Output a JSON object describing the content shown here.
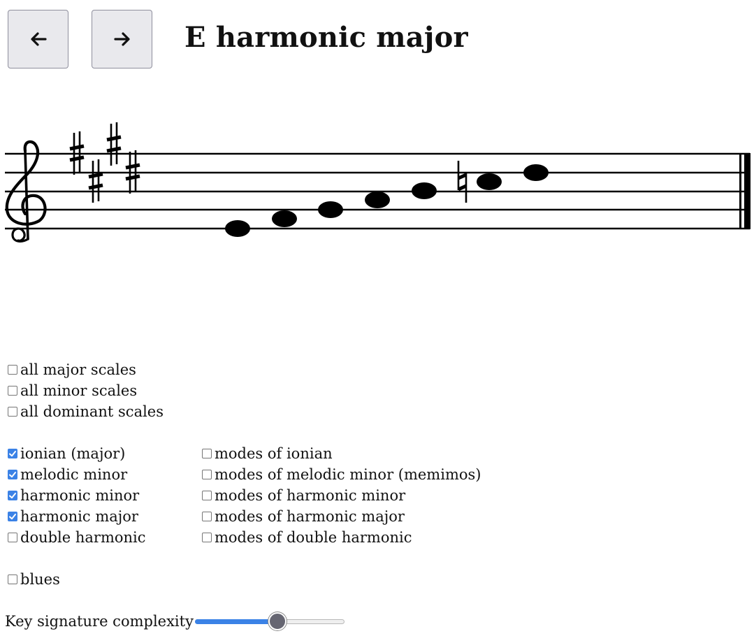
{
  "header": {
    "prev_icon": "arrow-left-icon",
    "next_icon": "arrow-right-icon",
    "title": "E harmonic major"
  },
  "staff": {
    "clef": "treble-clef",
    "key_signature": [
      "F#",
      "C#",
      "G#",
      "D#"
    ],
    "notes": [
      "E4",
      "F#4",
      "G#4",
      "A4",
      "B4",
      "C5",
      "D#5"
    ],
    "accidentals_on_notes": {
      "C5": "natural"
    },
    "ending": "final-barline"
  },
  "groups": [
    {
      "label": "all major scales",
      "checked": false
    },
    {
      "label": "all minor scales",
      "checked": false
    },
    {
      "label": "all dominant scales",
      "checked": false
    }
  ],
  "scales_left": [
    {
      "label": "ionian (major)",
      "checked": true
    },
    {
      "label": "melodic minor",
      "checked": true
    },
    {
      "label": "harmonic minor",
      "checked": true
    },
    {
      "label": "harmonic major",
      "checked": true
    },
    {
      "label": "double harmonic",
      "checked": false
    }
  ],
  "scales_right": [
    {
      "label": "modes of ionian",
      "checked": false
    },
    {
      "label": "modes of melodic minor (memimos)",
      "checked": false
    },
    {
      "label": "modes of harmonic minor",
      "checked": false
    },
    {
      "label": "modes of harmonic major",
      "checked": false
    },
    {
      "label": "modes of double harmonic",
      "checked": false
    }
  ],
  "blues": {
    "label": "blues",
    "checked": false
  },
  "complexity": {
    "label": "Key signature complexity",
    "value": 0.56
  },
  "colors": {
    "accent": "#3b82e6",
    "button_bg": "#e9e9ed"
  }
}
